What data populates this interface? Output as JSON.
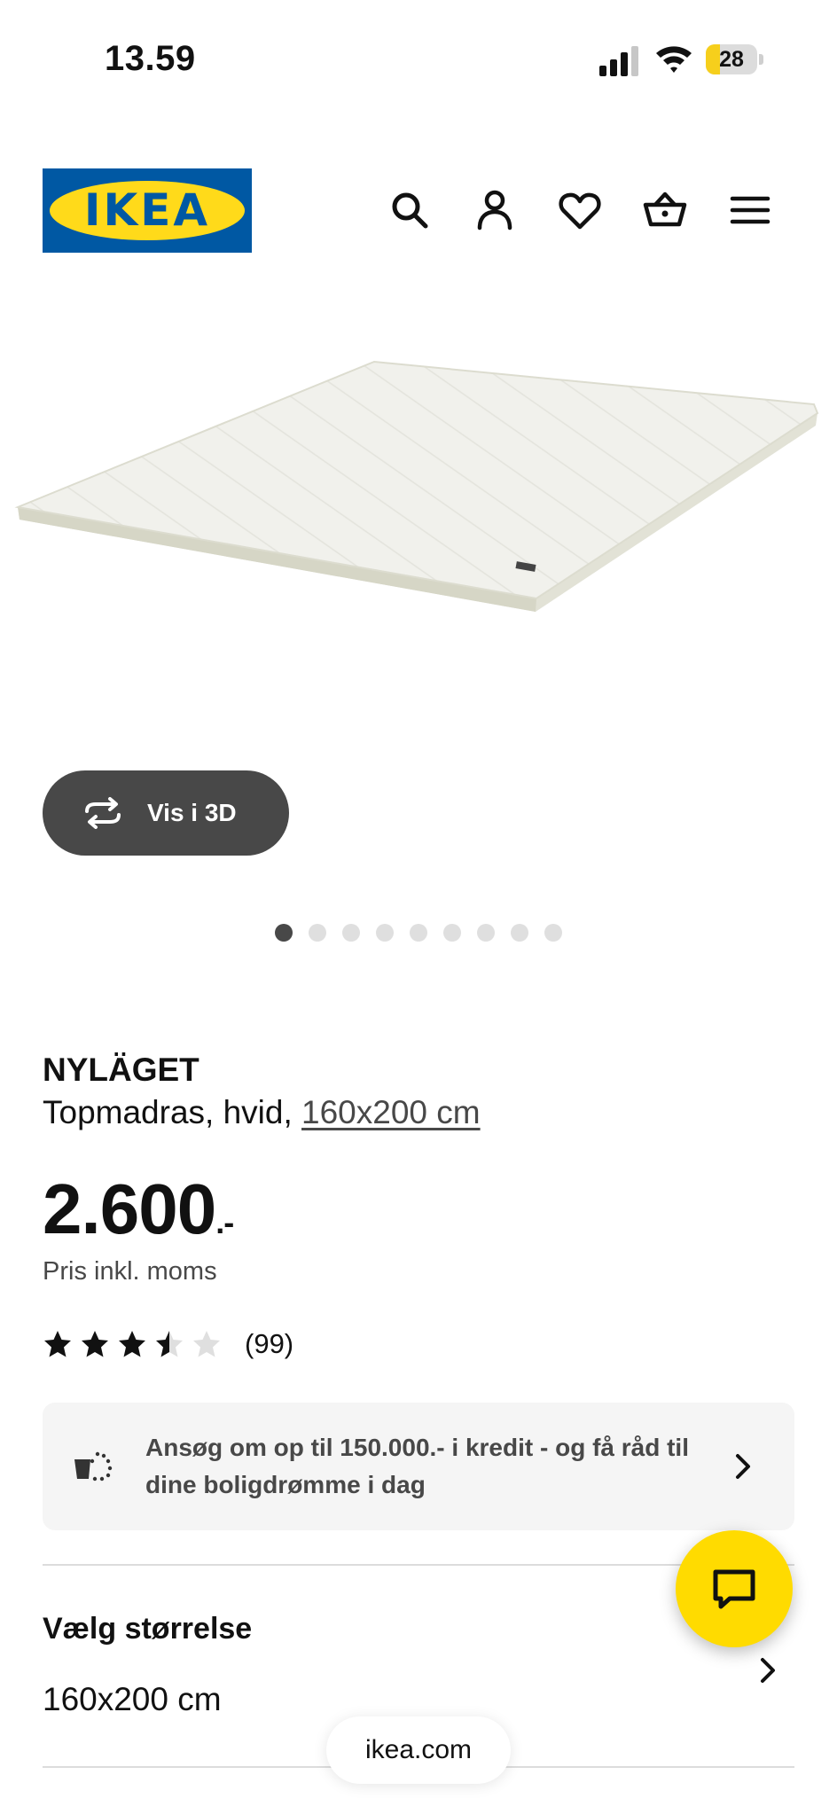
{
  "status_bar": {
    "time": "13.59",
    "battery_level": "28",
    "battery_fraction": 0.28
  },
  "header": {
    "logo_text": "IKEA",
    "icons": [
      "search-icon",
      "account-icon",
      "heart-icon",
      "basket-icon",
      "menu-icon"
    ]
  },
  "gallery": {
    "view_3d_label": "Vis i 3D",
    "image_count": 9,
    "active_index": 0
  },
  "product": {
    "name": "NYLÄGET",
    "description_prefix": "Topmadras, hvid, ",
    "size_link": "160x200 cm",
    "price": "2.600",
    "price_suffix": ".-",
    "price_note": "Pris inkl. moms",
    "rating": 3.5,
    "rating_max": 5,
    "review_count": "(99)"
  },
  "credit_banner": {
    "text": "Ansøg om op til 150.000.- i kredit - og få råd til dine boligdrømme i dag"
  },
  "size_selector": {
    "label": "Vælg størrelse",
    "value": "160x200 cm"
  },
  "browser": {
    "url": "ikea.com"
  },
  "colors": {
    "ikea_blue": "#0058a3",
    "ikea_yellow": "#ffda1a",
    "chat_yellow": "#ffdb00",
    "dark_gray": "#484848"
  }
}
